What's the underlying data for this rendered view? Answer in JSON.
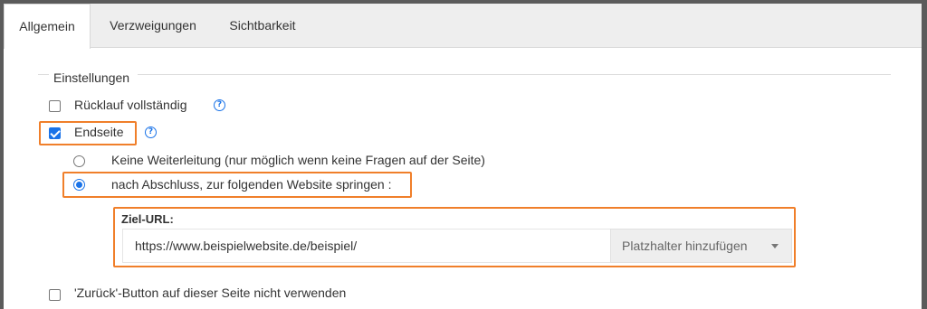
{
  "tabs": [
    {
      "label": "Allgemein",
      "active": true
    },
    {
      "label": "Verzweigungen",
      "active": false
    },
    {
      "label": "Sichtbarkeit",
      "active": false
    }
  ],
  "fieldset": {
    "legend": "Einstellungen"
  },
  "options": {
    "ruecklauf": {
      "label": "Rücklauf vollständig",
      "checked": false
    },
    "endseite": {
      "label": "Endseite",
      "checked": true
    },
    "keine_weiterleitung": {
      "label": "Keine Weiterleitung (nur möglich wenn keine Fragen auf der Seite)",
      "selected": false
    },
    "nach_abschluss": {
      "label": "nach Abschluss, zur folgenden Website springen :",
      "selected": true
    },
    "zurueck_button": {
      "label": "'Zurück'-Button auf dieser Seite nicht verwenden",
      "checked": false
    }
  },
  "redirect": {
    "url_label": "Ziel-URL:",
    "url_value": "https://www.beispielwebsite.de/beispiel/",
    "placeholder_button": "Platzhalter hinzufügen"
  },
  "help_icon_text": "?",
  "colors": {
    "accent": "#1a73e8",
    "highlight": "#f07f2a"
  }
}
